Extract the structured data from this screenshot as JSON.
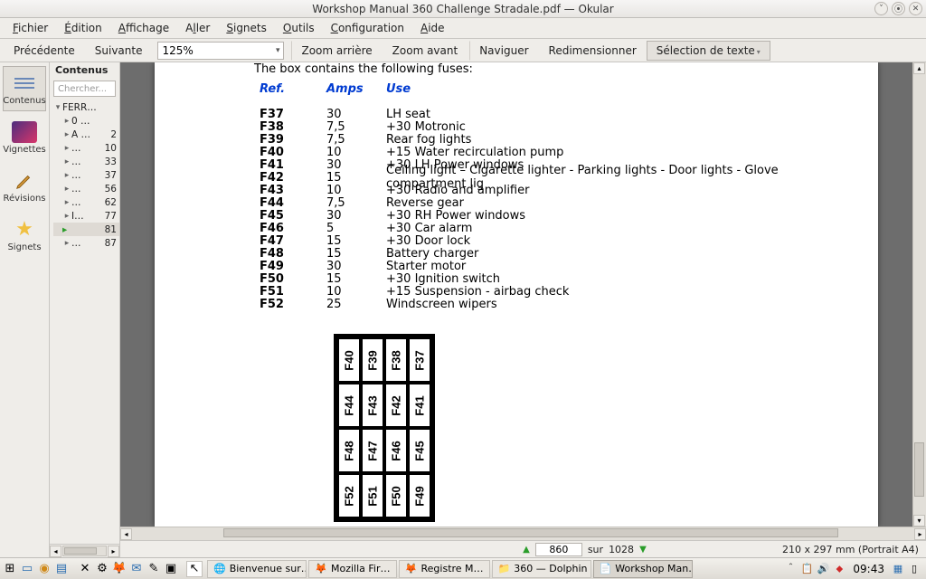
{
  "window": {
    "title": "Workshop Manual 360 Challenge Stradale.pdf — Okular"
  },
  "menu": {
    "file": "Fichier",
    "edit": "Édition",
    "view": "Affichage",
    "go": "Aller",
    "bookmarks": "Signets",
    "tools": "Outils",
    "config": "Configuration",
    "help": "Aide"
  },
  "toolbar": {
    "prev": "Précédente",
    "next": "Suivante",
    "zoom": "125%",
    "zoomout": "Zoom arrière",
    "zoomin": "Zoom avant",
    "browse": "Naviguer",
    "resize": "Redimensionner",
    "textsel": "Sélection de texte"
  },
  "iconbar": {
    "contents": "Contenus",
    "thumbs": "Vignettes",
    "reviews": "Révisions",
    "bookmarks": "Signets"
  },
  "contents": {
    "header": "Contenus",
    "search_placeholder": "Chercher...",
    "root": "FERR…",
    "items": [
      {
        "label": "0 …",
        "num": ""
      },
      {
        "label": "A … ",
        "num": "2"
      },
      {
        "label": "…",
        "num": "10"
      },
      {
        "label": "…",
        "num": "33"
      },
      {
        "label": "…",
        "num": "37"
      },
      {
        "label": "…",
        "num": "56"
      },
      {
        "label": "…",
        "num": "62"
      },
      {
        "label": "I…",
        "num": "77"
      },
      {
        "label": "",
        "num": "81",
        "current": true
      },
      {
        "label": "…",
        "num": "87"
      }
    ]
  },
  "doc": {
    "lead": "The box contains the following fuses:",
    "headers": {
      "ref": "Ref.",
      "amps": "Amps",
      "use": "Use"
    },
    "rows": [
      {
        "ref": "F37",
        "amps": "30",
        "use": "LH seat"
      },
      {
        "ref": "F38",
        "amps": "7,5",
        "use": "+30 Motronic"
      },
      {
        "ref": "F39",
        "amps": "7,5",
        "use": "Rear fog lights"
      },
      {
        "ref": "F40",
        "amps": "10",
        "use": "+15 Water recirculation pump"
      },
      {
        "ref": "F41",
        "amps": "30",
        "use": "+30 LH Power windows"
      },
      {
        "ref": "F42",
        "amps": "15",
        "use": "Ceiling light – Cigarette lighter - Parking lights - Door lights - Glove compartment lig"
      },
      {
        "ref": "F43",
        "amps": "10",
        "use": "+30 Radio and amplifier"
      },
      {
        "ref": "F44",
        "amps": "7,5",
        "use": "Reverse gear"
      },
      {
        "ref": "F45",
        "amps": "30",
        "use": "+30 RH Power windows"
      },
      {
        "ref": "F46",
        "amps": "5",
        "use": "+30 Car alarm"
      },
      {
        "ref": "F47",
        "amps": "15",
        "use": "+30 Door lock"
      },
      {
        "ref": "F48",
        "amps": "15",
        "use": "Battery charger"
      },
      {
        "ref": "F49",
        "amps": "30",
        "use": "Starter motor"
      },
      {
        "ref": "F50",
        "amps": "15",
        "use": "+30 Ignition switch"
      },
      {
        "ref": "F51",
        "amps": "10",
        "use": "+15 Suspension - airbag check"
      },
      {
        "ref": "F52",
        "amps": "25",
        "use": "Windscreen wipers"
      }
    ],
    "grid": [
      [
        "F40",
        "F39",
        "F38",
        "F37"
      ],
      [
        "F44",
        "F43",
        "F42",
        "F41"
      ],
      [
        "F48",
        "F47",
        "F46",
        "F45"
      ],
      [
        "F52",
        "F51",
        "F50",
        "F49"
      ]
    ]
  },
  "status": {
    "page": "860",
    "sep": "sur",
    "total": "1028",
    "dim": "210 x 297 mm (Portrait A4)"
  },
  "taskbar": {
    "items": [
      {
        "icon": "🌐",
        "label": "Bienvenue sur…"
      },
      {
        "icon": "🦊",
        "label": "Mozilla Fir…"
      },
      {
        "icon": "🦊",
        "label": "Registre M…"
      },
      {
        "icon": "📁",
        "label": "360 — Dolphin"
      },
      {
        "icon": "📄",
        "label": "Workshop Man…",
        "active": true
      }
    ],
    "clock": "09:43"
  },
  "chart_data": {
    "type": "table",
    "title": "The box contains the following fuses:",
    "columns": [
      "Ref.",
      "Amps",
      "Use"
    ],
    "rows": [
      [
        "F37",
        30,
        "LH seat"
      ],
      [
        "F38",
        7.5,
        "+30 Motronic"
      ],
      [
        "F39",
        7.5,
        "Rear fog lights"
      ],
      [
        "F40",
        10,
        "+15 Water recirculation pump"
      ],
      [
        "F41",
        30,
        "+30 LH Power windows"
      ],
      [
        "F42",
        15,
        "Ceiling light – Cigarette lighter - Parking lights - Door lights - Glove compartment lig"
      ],
      [
        "F43",
        10,
        "+30 Radio and amplifier"
      ],
      [
        "F44",
        7.5,
        "Reverse gear"
      ],
      [
        "F45",
        30,
        "+30 RH Power windows"
      ],
      [
        "F46",
        5,
        "+30 Car alarm"
      ],
      [
        "F47",
        15,
        "+30 Door lock"
      ],
      [
        "F48",
        15,
        "Battery charger"
      ],
      [
        "F49",
        30,
        "Starter motor"
      ],
      [
        "F50",
        15,
        "+30 Ignition switch"
      ],
      [
        "F51",
        10,
        "+15 Suspension - airbag check"
      ],
      [
        "F52",
        25,
        "Windscreen wipers"
      ]
    ],
    "layout_grid": [
      [
        "F40",
        "F39",
        "F38",
        "F37"
      ],
      [
        "F44",
        "F43",
        "F42",
        "F41"
      ],
      [
        "F48",
        "F47",
        "F46",
        "F45"
      ],
      [
        "F52",
        "F51",
        "F50",
        "F49"
      ]
    ]
  }
}
